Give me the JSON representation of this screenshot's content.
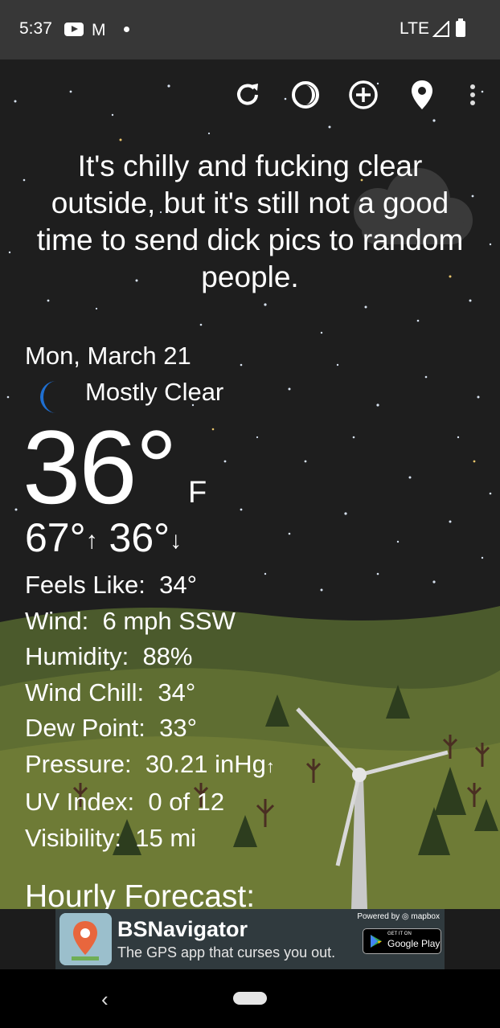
{
  "status_bar": {
    "time": "5:37",
    "gmail_glyph": "M",
    "network": "LTE",
    "icons": [
      "youtube-icon",
      "gmail-icon",
      "notification-dot-icon",
      "signal-icon",
      "battery-icon"
    ]
  },
  "toolbar": {
    "buttons": [
      "refresh-icon",
      "theme-icon",
      "add-location-icon",
      "location-pin-icon",
      "more-vert-icon"
    ]
  },
  "headline": "It's chilly and fucking clear outside, but it's still not a good time to send dick pics to random people.",
  "weather": {
    "date": "Mon, March 21",
    "condition": "Mostly Clear",
    "condition_icon": "moon-icon",
    "temperature": "36°",
    "unit": "F",
    "high": "67°",
    "low": "36°",
    "high_arrow": "↑",
    "low_arrow": "↓"
  },
  "details": [
    {
      "label": "Feels Like:",
      "value": "34°"
    },
    {
      "label": "Wind:",
      "value": "6 mph SSW"
    },
    {
      "label": "Humidity:",
      "value": "88%"
    },
    {
      "label": "Wind Chill:",
      "value": "34°"
    },
    {
      "label": "Dew Point:",
      "value": "33°"
    },
    {
      "label": "Pressure:",
      "value": "30.21 inHg",
      "trend": "↑"
    },
    {
      "label": "UV Index:",
      "value": "0 of 12"
    },
    {
      "label": "Visibility:",
      "value": "15 mi"
    }
  ],
  "hourly_title": "Hourly Forecast:",
  "ad": {
    "app_name": "BSNavigator",
    "tagline": "The GPS app that curses you out.",
    "powered_by": "Powered by ◎ mapbox",
    "store_small": "GET IT ON",
    "store_big": "Google Play"
  },
  "nav_bar": {
    "back": "‹"
  },
  "colors": {
    "status_bar": "#373737",
    "sky": "#1e1e1e",
    "moon": "#1f6fd1",
    "ad_bg": "#303a3e"
  }
}
